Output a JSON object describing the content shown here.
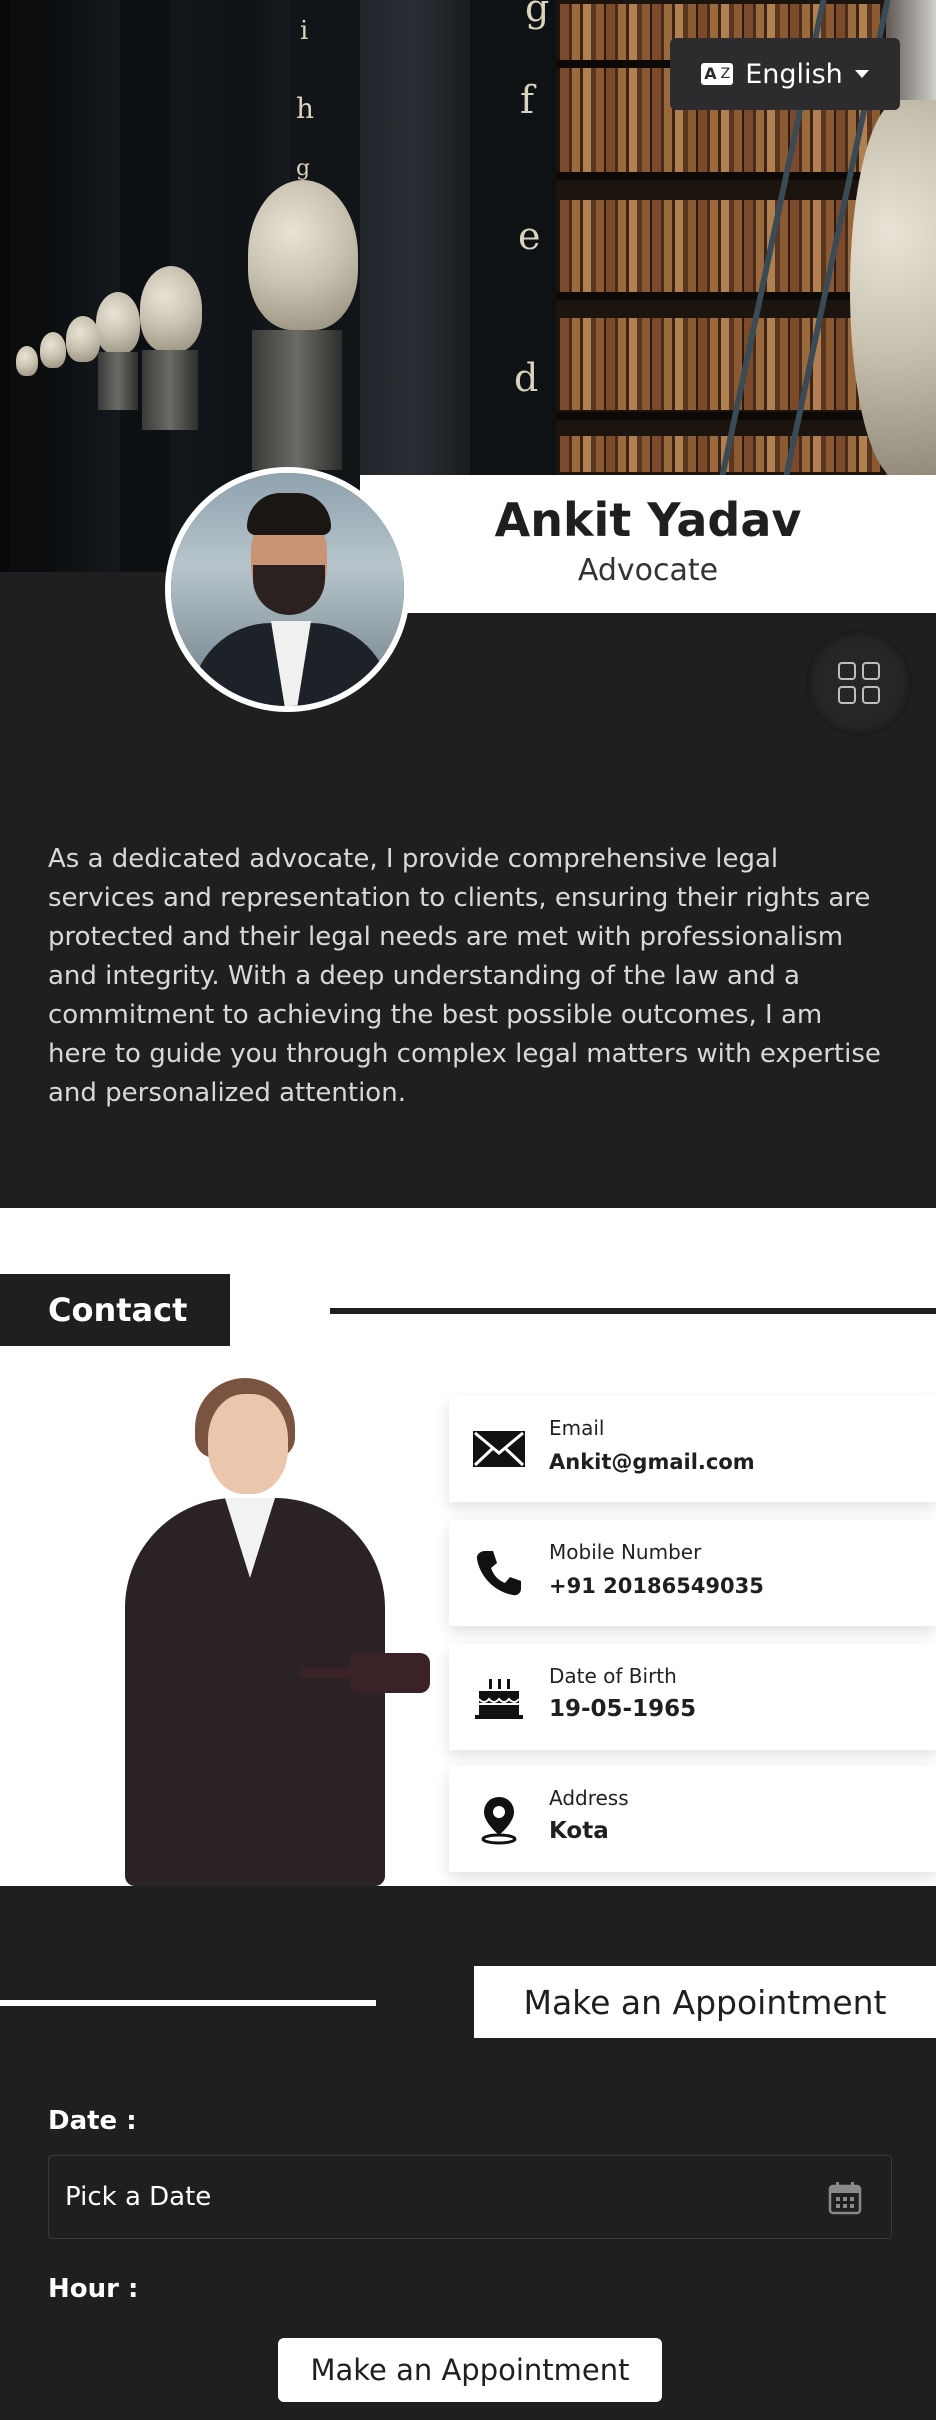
{
  "language": {
    "label": "English",
    "icon": "language-icon"
  },
  "profile": {
    "name": "Ankit Yadav",
    "role": "Advocate",
    "about": "As a dedicated advocate, I provide comprehensive legal services and representation to clients, ensuring their rights are protected and their legal needs are met with professionalism and integrity. With a deep understanding of the law and a commitment to achieving the best possible outcomes, I am here to guide you through complex legal matters with expertise and personalized attention."
  },
  "hero_letters": [
    "g",
    "i",
    "h",
    "f",
    "g",
    "e",
    "d"
  ],
  "contact": {
    "title": "Contact",
    "items": [
      {
        "label": "Email",
        "value": "Ankit@gmail.com",
        "icon": "envelope-icon"
      },
      {
        "label": "Mobile Number",
        "value": "+91 20186549035",
        "icon": "phone-icon"
      },
      {
        "label": "Date of Birth",
        "value": "19-05-1965",
        "icon": "cake-icon"
      },
      {
        "label": "Address",
        "value": "Kota",
        "icon": "map-pin-icon"
      }
    ]
  },
  "appointment": {
    "title": "Make an Appointment",
    "date_label": "Date :",
    "date_placeholder": "Pick a Date",
    "hour_label": "Hour :",
    "submit_label": "Make an Appointment"
  },
  "colors": {
    "dark": "#1f1f20",
    "white": "#ffffff"
  }
}
